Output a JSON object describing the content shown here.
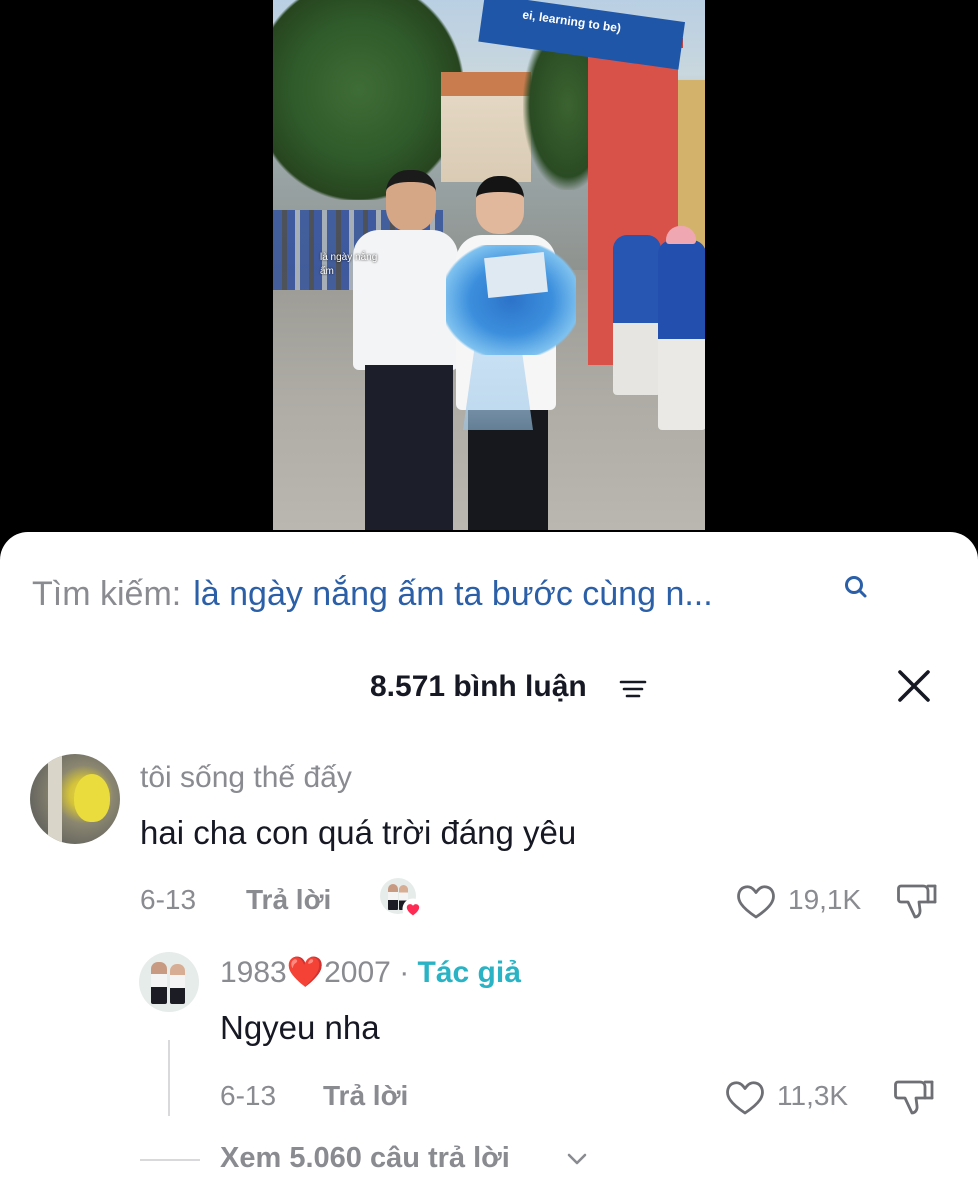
{
  "video": {
    "caption_overlay": "là ngày nắng ấm",
    "sign_text": "ei, learning to be)"
  },
  "search": {
    "label": "Tìm kiếm:",
    "query": "là ngày nắng ấm ta bước cùng n..."
  },
  "comments_header": {
    "count_label": "8.571 bình luận"
  },
  "comments": [
    {
      "username": "tôi sống thế đấy",
      "text": "hai cha con quá trời đáng yêu",
      "date": "6-13",
      "reply_label": "Trả lời",
      "likes": "19,1K"
    }
  ],
  "reply": {
    "username_prefix": "1983",
    "username_heart": "❤️",
    "username_suffix": "2007",
    "separator": " · ",
    "author_badge": "Tác giả",
    "text": "Ngyeu nha",
    "date": "6-13",
    "reply_label": "Trả lời",
    "likes": "11,3K"
  },
  "view_replies": {
    "label": "Xem 5.060 câu trả lời"
  },
  "colors": {
    "search_query": "#2b5fa8",
    "author_badge": "#2ab3c4",
    "muted_text": "#8a8b91",
    "primary_text": "#161823"
  }
}
